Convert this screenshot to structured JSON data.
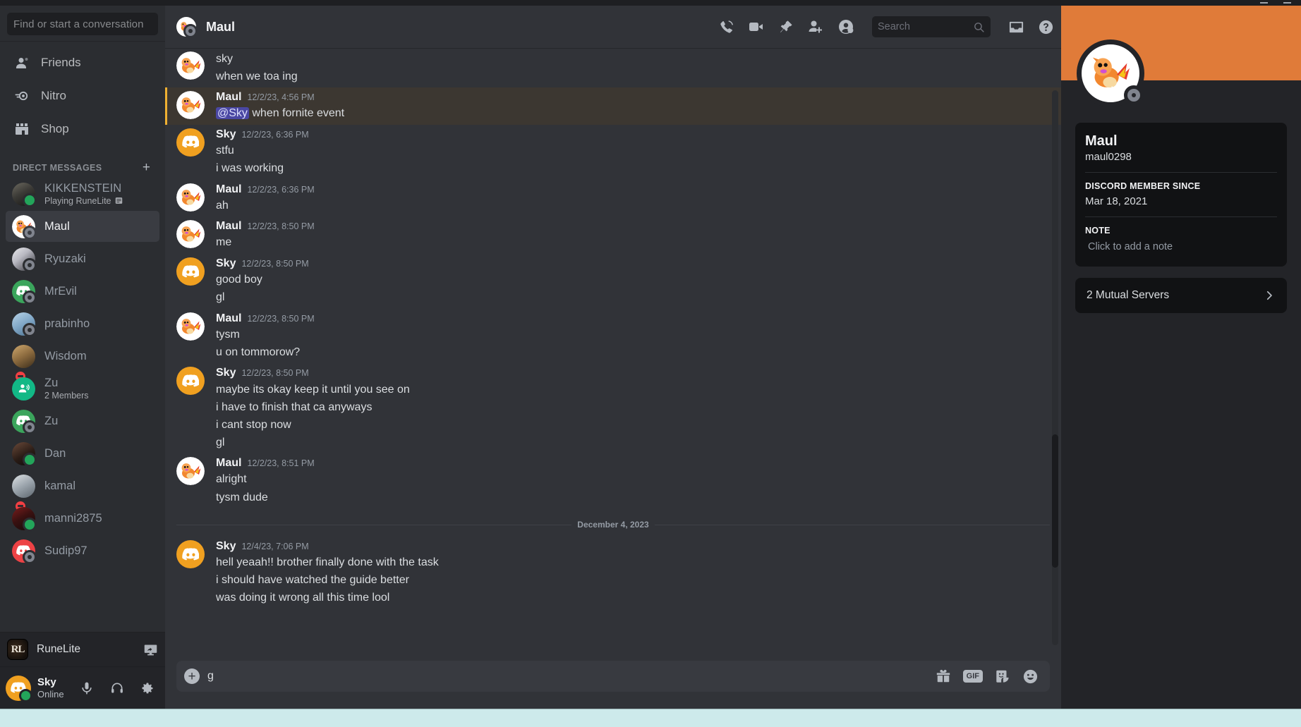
{
  "window": {
    "controls": [
      "minimize",
      "maximize",
      "close"
    ]
  },
  "sidebar": {
    "search_placeholder": "Find or start a conversation",
    "nav": [
      {
        "label": "Friends",
        "icon": "friends-icon"
      },
      {
        "label": "Nitro",
        "icon": "nitro-icon"
      },
      {
        "label": "Shop",
        "icon": "shop-icon"
      }
    ],
    "dm_header": {
      "label": "Direct Messages",
      "add_icon": "plus-icon"
    },
    "dms": [
      {
        "name": "KIKKENSTEIN",
        "sub": "Playing RuneLite",
        "sub_icon": "game-activity-icon",
        "status": "online",
        "avatar_kind": "photo-dark",
        "active": false
      },
      {
        "name": "Maul",
        "sub": "",
        "status": "offline",
        "avatar_kind": "charmander",
        "active": true
      },
      {
        "name": "Ryuzaki",
        "sub": "",
        "status": "offline",
        "avatar_kind": "photo-anime",
        "active": false
      },
      {
        "name": "MrEvil",
        "sub": "",
        "status": "offline",
        "avatar_kind": "discord-green",
        "active": false
      },
      {
        "name": "prabinho",
        "sub": "",
        "status": "offline",
        "avatar_kind": "photo-blue",
        "active": false
      },
      {
        "name": "Wisdom",
        "sub": "",
        "status": "dnd",
        "avatar_kind": "photo-brown",
        "active": false
      },
      {
        "name": "Zu",
        "sub": "2 Members",
        "status": "group",
        "avatar_kind": "group-teal",
        "active": false
      },
      {
        "name": "Zu",
        "sub": "",
        "status": "offline",
        "avatar_kind": "discord-green",
        "active": false
      },
      {
        "name": "Dan",
        "sub": "",
        "status": "online",
        "avatar_kind": "photo-face",
        "active": false
      },
      {
        "name": "kamal",
        "sub": "",
        "status": "dnd",
        "avatar_kind": "photo-person",
        "active": false
      },
      {
        "name": "manni2875",
        "sub": "",
        "status": "online",
        "avatar_kind": "photo-red",
        "active": false
      },
      {
        "name": "Sudip97",
        "sub": "",
        "status": "offline",
        "avatar_kind": "discord-red",
        "active": false
      }
    ],
    "activity": {
      "app_name": "RuneLite",
      "icon_text": "RL",
      "screenshare_icon": "screenshare-icon"
    },
    "user": {
      "name": "Sky",
      "status": "Online",
      "buttons": [
        "microphone-icon",
        "headset-icon",
        "settings-gear-icon"
      ]
    }
  },
  "chat_header": {
    "title": "Maul",
    "avatar_status": "offline",
    "icons": [
      "voice-call-icon",
      "video-call-icon",
      "pin-icon",
      "add-friend-icon",
      "show-profile-icon"
    ],
    "search_placeholder": "Search",
    "right_icons": [
      "inbox-icon",
      "help-icon"
    ]
  },
  "messages": {
    "groups": [
      {
        "author": "Maul",
        "time": "",
        "continued_top": true,
        "mention": false,
        "avatar_kind": "charmander",
        "lines": [
          {
            "text": "sky"
          },
          {
            "text": "when we toa ing"
          }
        ]
      },
      {
        "author": "Maul",
        "time": "12/2/23, 4:56 PM",
        "mention": true,
        "avatar_kind": "charmander",
        "lines": [
          {
            "text": "when fornite event",
            "mention_prefix": "@Sky"
          }
        ]
      },
      {
        "author": "Sky",
        "time": "12/2/23, 6:36 PM",
        "mention": false,
        "avatar_kind": "discord-orange",
        "lines": [
          {
            "text": "stfu"
          },
          {
            "text": "i was working"
          }
        ]
      },
      {
        "author": "Maul",
        "time": "12/2/23, 6:36 PM",
        "mention": false,
        "avatar_kind": "charmander",
        "lines": [
          {
            "text": "ah"
          }
        ]
      },
      {
        "author": "Maul",
        "time": "12/2/23, 8:50 PM",
        "mention": false,
        "avatar_kind": "charmander",
        "lines": [
          {
            "text": "me"
          }
        ]
      },
      {
        "author": "Sky",
        "time": "12/2/23, 8:50 PM",
        "mention": false,
        "avatar_kind": "discord-orange",
        "lines": [
          {
            "text": "good boy"
          },
          {
            "text": "gl"
          }
        ]
      },
      {
        "author": "Maul",
        "time": "12/2/23, 8:50 PM",
        "mention": false,
        "avatar_kind": "charmander",
        "lines": [
          {
            "text": "tysm"
          },
          {
            "text": "u on tommorow?"
          }
        ]
      },
      {
        "author": "Sky",
        "time": "12/2/23, 8:50 PM",
        "mention": false,
        "avatar_kind": "discord-orange",
        "lines": [
          {
            "text": "maybe its okay keep it until you see on"
          },
          {
            "text": "i have to finish that ca anyways"
          },
          {
            "text": "i cant stop now"
          },
          {
            "text": "gl"
          }
        ]
      },
      {
        "author": "Maul",
        "time": "12/2/23, 8:51 PM",
        "mention": false,
        "avatar_kind": "charmander",
        "lines": [
          {
            "text": "alright"
          },
          {
            "text": "tysm dude"
          }
        ]
      }
    ],
    "date_divider": "December 4, 2023",
    "groups_after": [
      {
        "author": "Sky",
        "time": "12/4/23, 7:06 PM",
        "mention": false,
        "avatar_kind": "discord-orange",
        "lines": [
          {
            "text": "hell yeaah!! brother finally done with the task"
          },
          {
            "text": "i should have watched the guide better"
          },
          {
            "text": "was doing it wrong all this time lool"
          }
        ]
      }
    ]
  },
  "composer": {
    "value": "g",
    "add_icon": "plus-circle-icon",
    "icons": [
      "gift-icon",
      "gif-icon",
      "sticker-icon",
      "emoji-icon"
    ],
    "gif_label": "GIF"
  },
  "profile": {
    "banner_color": "#e07b39",
    "display_name": "Maul",
    "username": "maul0298",
    "member_since_label": "Discord Member Since",
    "member_since_value": "Mar 18, 2021",
    "note_label": "Note",
    "note_placeholder": "Click to add a note",
    "mutual_servers": "2 Mutual Servers",
    "mutual_chevron": "chevron-right-icon",
    "status": "offline"
  },
  "taskbar": {
    "time": ""
  }
}
